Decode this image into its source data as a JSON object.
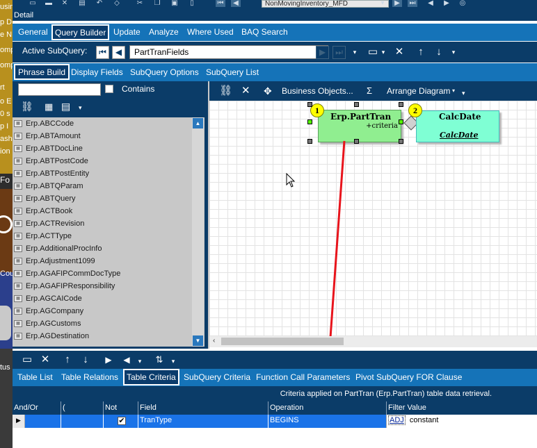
{
  "desktop": {
    "fragments": [
      "usin",
      "p D",
      "e N",
      "omp",
      "omp",
      "rt",
      "o E",
      "0 s",
      "p I",
      "ash",
      "ion",
      "Fo",
      "Cou",
      "tus"
    ]
  },
  "top_toolbar": {
    "title_combo_value": "NonMovingInventory_MFD"
  },
  "detail_label": "Detail",
  "main_tabs": [
    {
      "label": "General"
    },
    {
      "label": "Query Builder"
    },
    {
      "label": "Update"
    },
    {
      "label": "Analyze"
    },
    {
      "label": "Where Used"
    },
    {
      "label": "BAQ Search"
    }
  ],
  "subquery_bar": {
    "label": "Active SubQuery:",
    "combo_value": "PartTranFields"
  },
  "phrase_tabs": [
    {
      "label": "Phrase Build"
    },
    {
      "label": "Display Fields"
    },
    {
      "label": "SubQuery Options"
    },
    {
      "label": "SubQuery List"
    }
  ],
  "search": {
    "placeholder": "",
    "contains_label": "Contains"
  },
  "table_list": [
    "Erp.ABCCode",
    "Erp.ABTAmount",
    "Erp.ABTDocLine",
    "Erp.ABTPostCode",
    "Erp.ABTPostEntity",
    "Erp.ABTQParam",
    "Erp.ABTQuery",
    "Erp.ACTBook",
    "Erp.ACTRevision",
    "Erp.ACTType",
    "Erp.AdditionalProcInfo",
    "Erp.Adjustment1099",
    "Erp.AGAFIPCommDocType",
    "Erp.AGAFIPResponsibility",
    "Erp.AGCAICode",
    "Erp.AGCompany",
    "Erp.AGCustoms",
    "Erp.AGDestination"
  ],
  "diagram_toolbar": {
    "business_objects": "Business Objects...",
    "sigma": "Σ",
    "arrange": "Arrange Diagram"
  },
  "diagram": {
    "node1": {
      "badge": "1",
      "title": "Erp.PartTran",
      "subtitle": "+criteria",
      "color": "#90ee90"
    },
    "node2": {
      "badge": "2",
      "title": "CalcDate",
      "subtitle": "CalcDate",
      "color": "#7fffd4"
    }
  },
  "criteria_tabs": [
    {
      "label": "Table List"
    },
    {
      "label": "Table Relations"
    },
    {
      "label": "Table Criteria"
    },
    {
      "label": "SubQuery Criteria"
    },
    {
      "label": "Function Call Parameters"
    },
    {
      "label": "Pivot SubQuery FOR Clause"
    }
  ],
  "criteria_caption": "Criteria applied on PartTran (Erp.PartTran) table data retrieval.",
  "grid": {
    "headers": [
      "And/Or",
      "(",
      "Not",
      "Field",
      "Operation",
      "Filter Value"
    ],
    "row": {
      "and_or": "",
      "paren": "",
      "not_checked": true,
      "field": "TranType",
      "operation": "BEGINS",
      "filter_badge": "ADJ",
      "filter_value": "constant"
    }
  },
  "colors": {
    "dark_navy": "#0b3c68",
    "tab_blue": "#1573b8",
    "arrow_red": "#e8141c"
  }
}
